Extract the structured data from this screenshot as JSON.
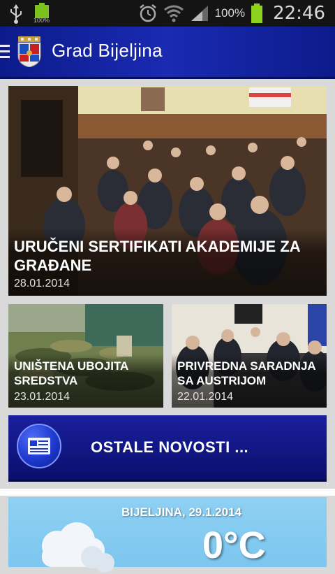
{
  "status_bar": {
    "time": "22:46",
    "battery_percent": "100%",
    "small_battery_label": "100%",
    "icons": [
      "usb-icon",
      "battery-icon",
      "alarm-icon",
      "wifi-icon",
      "signal-icon",
      "battery-icon"
    ]
  },
  "app_bar": {
    "title": "Grad Bijeljina",
    "accent": "#1a2ab2"
  },
  "news": [
    {
      "headline": "URUČENI SERTIFIKATI AKADEMIJE ZA GRAĐANE",
      "date": "28.01.2014"
    },
    {
      "headline": "UNIŠTENA UBOJITA SREDSTVA",
      "date": "23.01.2014"
    },
    {
      "headline": "PRIVREDNA SARADNjA SA AUSTRIJOM",
      "date": "22.01.2014"
    }
  ],
  "more_news": {
    "label": "OSTALE NOVOSTI ...",
    "icon": "newspaper-icon"
  },
  "weather": {
    "title": "BIJELJINA, 29.1.2014",
    "temperature": "0°C",
    "icon": "cloud-icon"
  }
}
